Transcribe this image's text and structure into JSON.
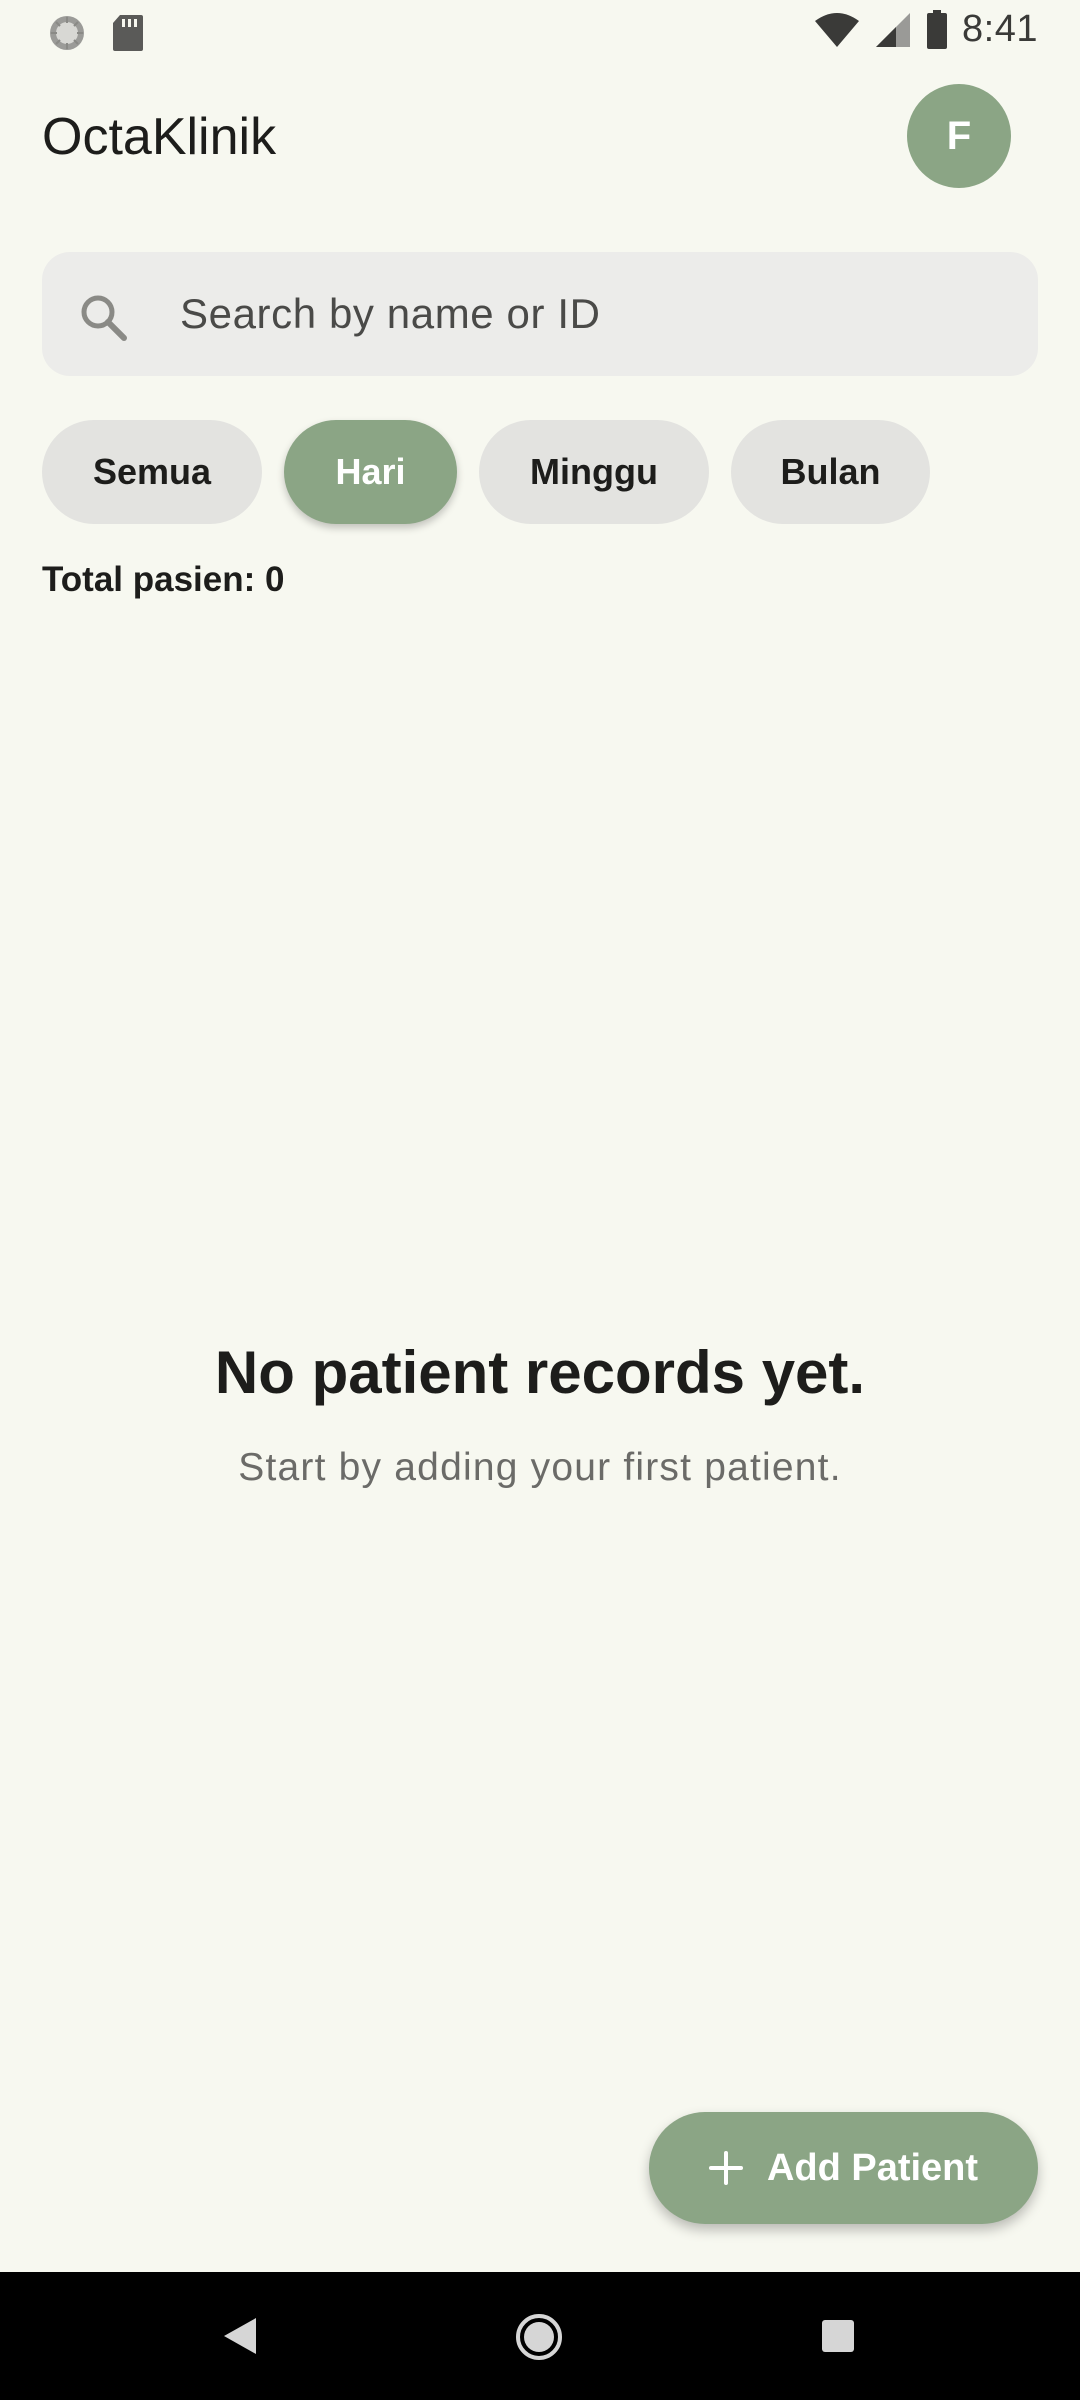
{
  "status_bar": {
    "time": "8:41",
    "left_icons": [
      "loading-dots-icon",
      "sd-card-icon"
    ],
    "right_icons": [
      "wifi-icon",
      "cell-signal-icon",
      "battery-icon"
    ]
  },
  "app_bar": {
    "title": "OctaKlinik",
    "avatar_initial": "F"
  },
  "search": {
    "placeholder": "Search by name or ID",
    "value": ""
  },
  "filters": {
    "chips": [
      {
        "label": "Semua",
        "selected": false
      },
      {
        "label": "Hari",
        "selected": true
      },
      {
        "label": "Minggu",
        "selected": false
      },
      {
        "label": "Bulan",
        "selected": false
      }
    ]
  },
  "summary": {
    "total_text": "Total pasien: 0"
  },
  "empty_state": {
    "title": "No patient records yet.",
    "subtitle": "Start by adding your first patient."
  },
  "fab": {
    "label": "Add Patient",
    "icon": "plus-icon"
  },
  "nav": {
    "buttons": [
      "back-icon",
      "home-icon",
      "recents-icon"
    ]
  },
  "colors": {
    "background": "#f7f8f0",
    "accent": "#8ba585",
    "chip_default": "#e3e3e0",
    "search_background": "#ececea"
  }
}
